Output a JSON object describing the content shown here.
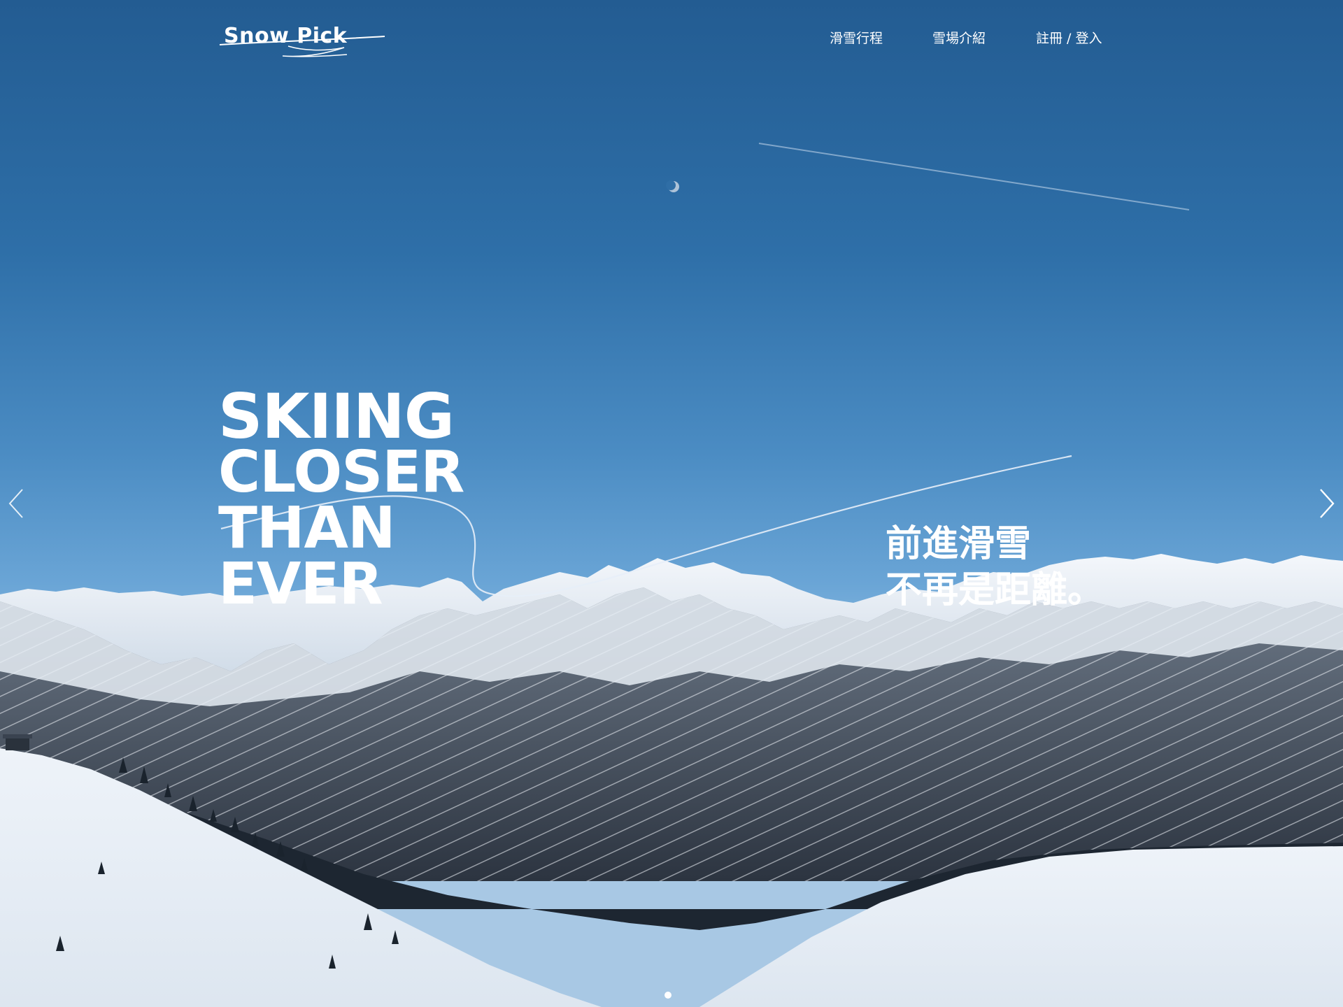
{
  "logo": {
    "text": "Snow Pick",
    "alt": "Snow Pick logo"
  },
  "nav": {
    "items": [
      {
        "label": "滑雪行程"
      },
      {
        "label": "雪場介紹"
      },
      {
        "label": "註冊 / 登入"
      }
    ]
  },
  "hero": {
    "headline": [
      "SKIING",
      "CLOSER",
      "THAN",
      "EVER"
    ],
    "tagline": [
      "前進滑雪",
      "不再是距離。"
    ],
    "slides": {
      "count": 1,
      "active": 1
    }
  },
  "icons": {
    "prev": "chevron-left-icon",
    "next": "chevron-right-icon"
  },
  "colors": {
    "sky_top": "#235c92",
    "sky_horizon": "#a8c8e4",
    "text": "#ffffff"
  }
}
